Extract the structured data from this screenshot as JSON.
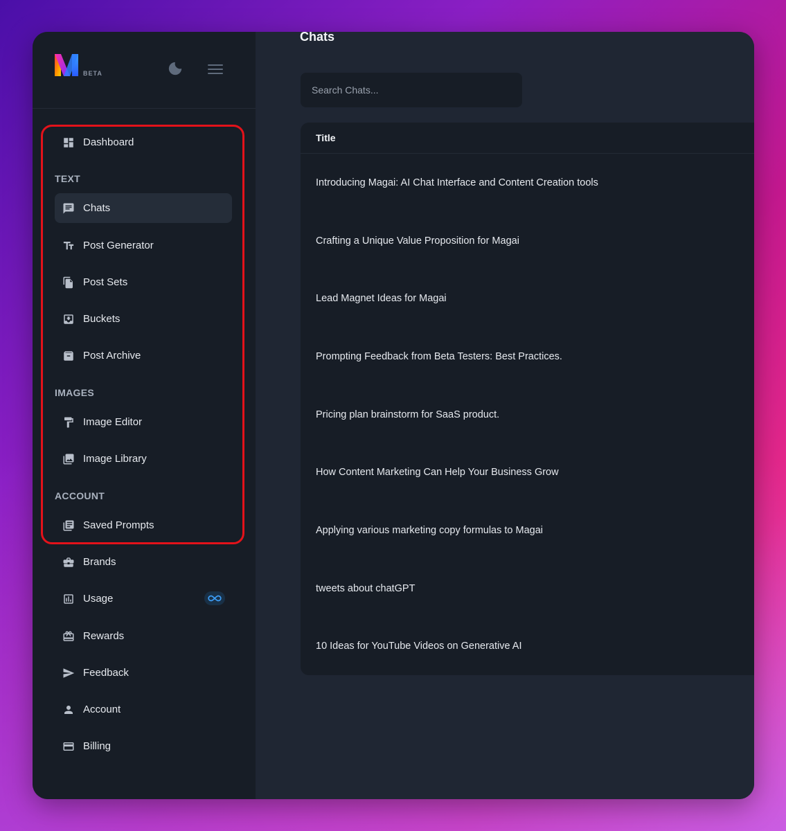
{
  "app": {
    "logo_badge": "BETA",
    "colors": {
      "accent": "#e3121a",
      "sidebar_bg": "#171d26",
      "main_bg": "#1f2633"
    }
  },
  "sidebar": {
    "dashboard": {
      "label": "Dashboard",
      "icon": "dashboard-icon"
    },
    "sections": {
      "text": "TEXT",
      "images": "IMAGES",
      "account": "ACCOUNT"
    },
    "items": [
      {
        "label": "Chats",
        "icon": "chat-icon",
        "active": true
      },
      {
        "label": "Post Generator",
        "icon": "text-format-icon"
      },
      {
        "label": "Post Sets",
        "icon": "copy-icon"
      },
      {
        "label": "Buckets",
        "icon": "inbox-icon"
      },
      {
        "label": "Post Archive",
        "icon": "archive-icon"
      },
      {
        "label": "Image Editor",
        "icon": "paint-roller-icon"
      },
      {
        "label": "Image Library",
        "icon": "image-library-icon"
      },
      {
        "label": "Saved Prompts",
        "icon": "library-books-icon"
      },
      {
        "label": "Brands",
        "icon": "briefcase-icon"
      },
      {
        "label": "Usage",
        "icon": "bar-chart-icon",
        "badge": "infinity-icon"
      },
      {
        "label": "Rewards",
        "icon": "gift-card-icon"
      },
      {
        "label": "Feedback",
        "icon": "send-icon"
      },
      {
        "label": "Account",
        "icon": "person-icon"
      },
      {
        "label": "Billing",
        "icon": "credit-card-icon"
      }
    ]
  },
  "main": {
    "title": "Chats",
    "search": {
      "placeholder": "Search Chats..."
    },
    "table": {
      "header": "Title",
      "rows": [
        "Introducing Magai: AI Chat Interface and Content Creation tools",
        "Crafting a Unique Value Proposition for Magai",
        "Lead Magnet Ideas for Magai",
        "Prompting Feedback from Beta Testers: Best Practices.",
        "Pricing plan brainstorm for SaaS product.",
        "How Content Marketing Can Help Your Business Grow",
        "Applying various marketing copy formulas to Magai",
        "tweets about chatGPT",
        "10 Ideas for YouTube Videos on Generative AI"
      ]
    }
  }
}
